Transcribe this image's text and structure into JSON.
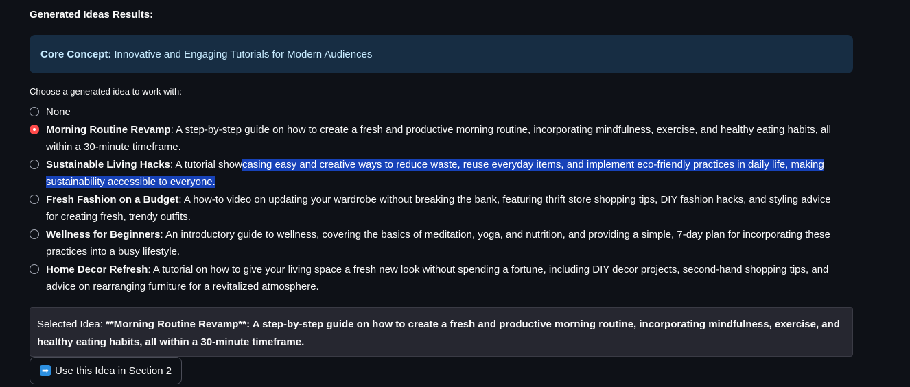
{
  "heading": "Generated Ideas Results:",
  "core_concept": {
    "label": "Core Concept:",
    "value": "Innovative and Engaging Tutorials for Modern Audiences"
  },
  "radio": {
    "label": "Choose a generated idea to work with:",
    "options": [
      {
        "title": "None",
        "description": "",
        "selected": false
      },
      {
        "title": "Morning Routine Revamp",
        "description": ": A step-by-step guide on how to create a fresh and productive morning routine, incorporating mindfulness, exercise, and healthy eating habits, all within a 30-minute timeframe.",
        "selected": true
      },
      {
        "title": "Sustainable Living Hacks",
        "description_pre": ": A tutorial show",
        "description_highlight": "casing easy and creative ways to reduce waste, reuse everyday items, and implement eco-friendly practices in daily life, making sustainability accessible to everyone.",
        "selected": false
      },
      {
        "title": "Fresh Fashion on a Budget",
        "description": ": A how-to video on updating your wardrobe without breaking the bank, featuring thrift store shopping tips, DIY fashion hacks, and styling advice for creating fresh, trendy outfits.",
        "selected": false
      },
      {
        "title": "Wellness for Beginners",
        "description": ": An introductory guide to wellness, covering the basics of meditation, yoga, and nutrition, and providing a simple, 7-day plan for incorporating these practices into a busy lifestyle.",
        "selected": false
      },
      {
        "title": "Home Decor Refresh",
        "description": ": A tutorial on how to give your living space a fresh new look without spending a fortune, including DIY decor projects, second-hand shopping tips, and advice on rearranging furniture for a revitalized atmosphere.",
        "selected": false
      }
    ]
  },
  "selected_idea": {
    "prefix": "Selected Idea: ",
    "text": "**Morning Routine Revamp**: A step-by-step guide on how to create a fresh and productive morning routine, incorporating mindfulness, exercise, and healthy eating habits, all within a 30-minute timeframe."
  },
  "action_button": {
    "icon": "right-arrow-icon",
    "label": "Use this Idea in Section 2"
  },
  "colors": {
    "background": "#0e1117",
    "info_bg": "#172d43",
    "info_text": "#c7ebff",
    "accent": "#ff4b4b",
    "highlight": "#1742b8"
  }
}
